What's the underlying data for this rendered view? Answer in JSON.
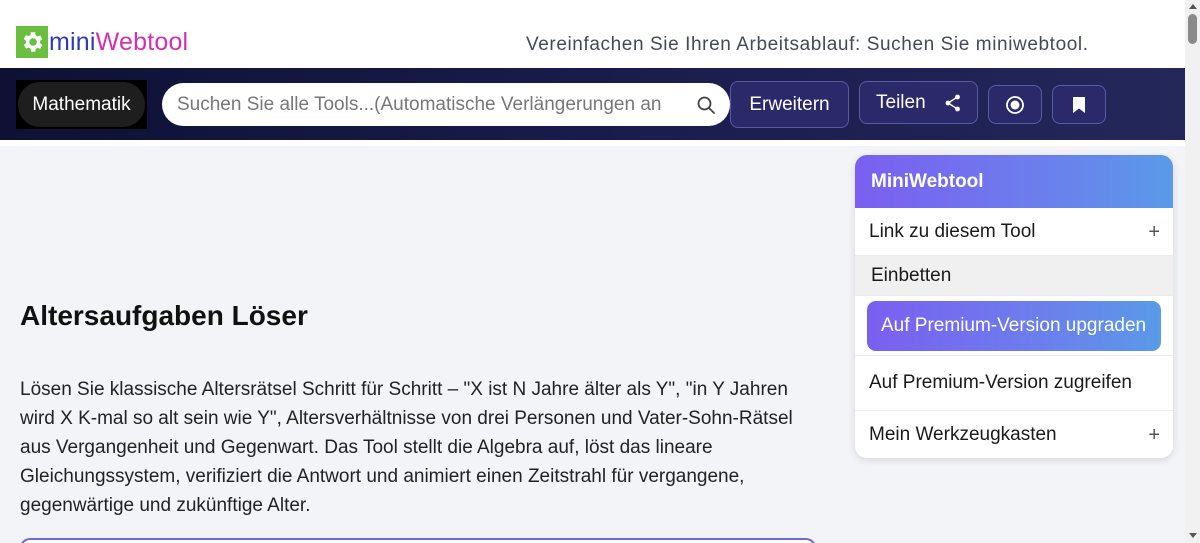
{
  "header": {
    "logo_mini": "mini",
    "logo_web": "Webtool",
    "tagline": "Vereinfachen Sie Ihren Arbeitsablauf: Suchen Sie miniwebtool."
  },
  "nav": {
    "category_label": "Mathematik",
    "search_placeholder": "Suchen Sie alle Tools...(Automatische Verlängerungen an",
    "expand_label": "Erweitern",
    "share_label": "Teilen"
  },
  "main": {
    "title": "Altersaufgaben Löser",
    "description": "Lösen Sie klassische Altersrätsel Schritt für Schritt – \"X ist N Jahre älter als Y\", \"in Y Jahren wird X K-mal so alt sein wie Y\", Altersverhältnisse von drei Personen und Vater-Sohn-Rätsel aus Vergangenheit und Gegenwart. Das Tool stellt die Algebra auf, löst das lineare Gleichungssystem, verifiziert die Antwort und animiert einen Zeitstrahl für vergangene, gegenwärtige und zukünftige Alter."
  },
  "panel": {
    "title": "MiniWebtool",
    "link_label": "Link zu diesem Tool",
    "embed_label": "Einbetten",
    "upgrade_label": "Auf Premium-Version upgraden",
    "access_label": "Auf Premium-Version zugreifen",
    "toolbox_label": "Mein Werkzeugkasten",
    "expand_symbol": "+"
  },
  "colors": {
    "logo_green": "#6bbf3e",
    "logo_blue": "#2e3ab8",
    "logo_pink": "#d42fb0",
    "nav_dark": "#0e1133",
    "accent_purple": "#7b5ff0",
    "accent_blue": "#5a9ae8"
  },
  "icons": {
    "logo": "gear-icon",
    "search": "search-icon",
    "share": "share-icon",
    "record": "record-icon",
    "bookmark": "bookmark-icon"
  }
}
